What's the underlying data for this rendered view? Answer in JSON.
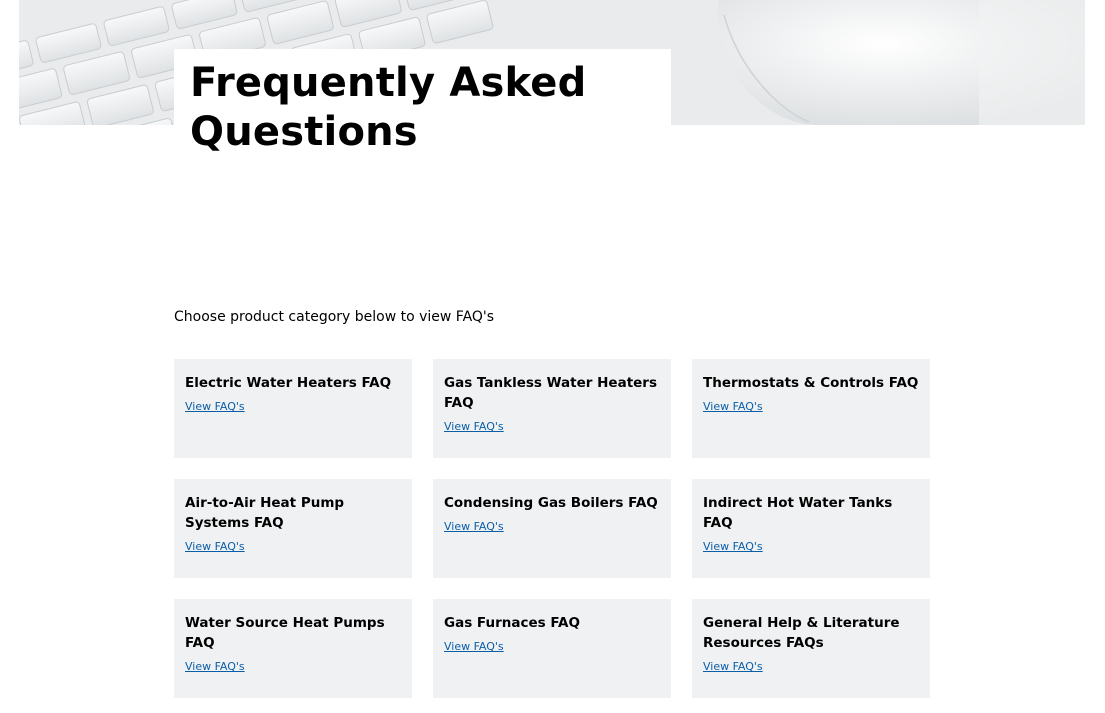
{
  "hero": {
    "title": "Frequently Asked Questions",
    "image": "keyboard-and-mouse-photo"
  },
  "intro_text": "Choose product category below to view FAQ's",
  "categories": [
    {
      "title": "Electric Water Heaters FAQ",
      "link": "View FAQ's"
    },
    {
      "title": "Gas Tankless Water Heaters FAQ",
      "link": "View FAQ's"
    },
    {
      "title": "Thermostats & Controls FAQ",
      "link": "View FAQ's"
    },
    {
      "title": "Air-to-Air Heat Pump Systems FAQ",
      "link": "View FAQ's"
    },
    {
      "title": "Condensing Gas Boilers FAQ",
      "link": "View FAQ's"
    },
    {
      "title": "Indirect Hot Water Tanks FAQ",
      "link": "View FAQ's"
    },
    {
      "title": "Water Source Heat Pumps FAQ",
      "link": "View FAQ's"
    },
    {
      "title": "Gas Furnaces FAQ",
      "link": "View FAQ's"
    },
    {
      "title": "General Help & Literature Resources FAQs",
      "link": "View FAQ's"
    }
  ],
  "colors": {
    "card_bg": "#eff1f2",
    "link": "#0a5ea8"
  }
}
